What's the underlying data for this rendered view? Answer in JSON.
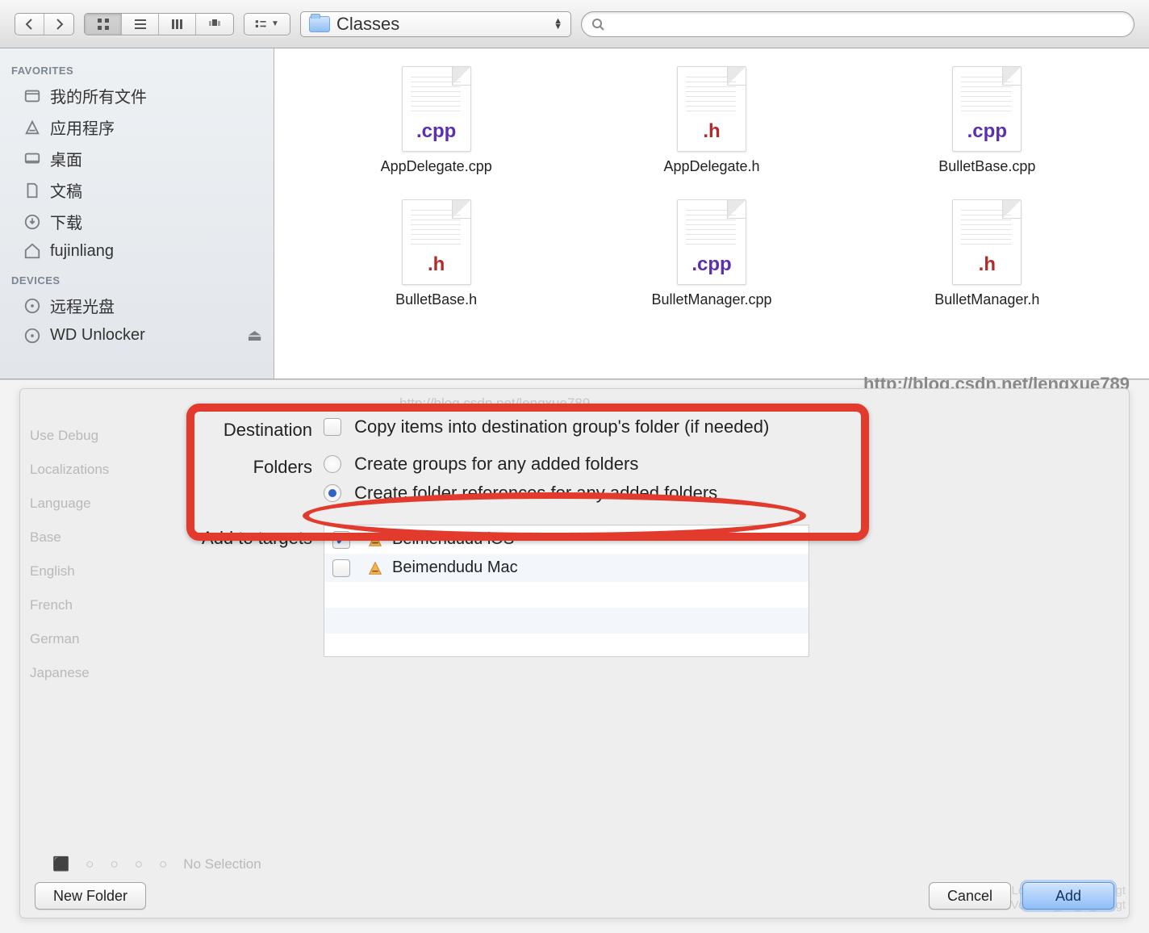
{
  "toolbar": {
    "path_label": "Classes",
    "search_placeholder": ""
  },
  "sidebar": {
    "section_favorites": "FAVORITES",
    "section_devices": "DEVICES",
    "favorites": [
      {
        "label": "我的所有文件",
        "icon": "all-files"
      },
      {
        "label": "应用程序",
        "icon": "apps"
      },
      {
        "label": "桌面",
        "icon": "desktop"
      },
      {
        "label": "文稿",
        "icon": "documents"
      },
      {
        "label": "下载",
        "icon": "downloads"
      },
      {
        "label": "fujinliang",
        "icon": "home"
      }
    ],
    "devices": [
      {
        "label": "远程光盘",
        "icon": "disc",
        "eject": false
      },
      {
        "label": "WD Unlocker",
        "icon": "disc",
        "eject": true
      }
    ]
  },
  "files": [
    {
      "name": "AppDelegate.cpp",
      "ext": ".cpp",
      "cls": "cpp"
    },
    {
      "name": "AppDelegate.h",
      "ext": ".h",
      "cls": "h"
    },
    {
      "name": "BulletBase.cpp",
      "ext": ".cpp",
      "cls": "cpp"
    },
    {
      "name": "BulletBase.h",
      "ext": ".h",
      "cls": "h"
    },
    {
      "name": "BulletManager.cpp",
      "ext": ".cpp",
      "cls": "cpp"
    },
    {
      "name": "BulletManager.h",
      "ext": ".h",
      "cls": "h"
    }
  ],
  "sheet": {
    "watermark_bold": "http://blog.csdn.net/lengxue789",
    "watermark_faint": "http://blog.csdn.net/lengxue789",
    "destination_label": "Destination",
    "copy_items_label": "Copy items into destination group's folder (if needed)",
    "folders_label": "Folders",
    "create_groups_label": "Create groups for any added folders",
    "create_refs_label": "Create folder references for any added folders",
    "targets_label": "Add to targets",
    "targets": [
      {
        "name": "Beimendudu iOS",
        "checked": true
      },
      {
        "name": "Beimendudu Mac",
        "checked": false
      }
    ],
    "new_folder": "New Folder",
    "cancel": "Cancel",
    "add": "Add"
  },
  "ghost": {
    "items": [
      "Use    Debug",
      "Localizations",
      "Language",
      "Base",
      "English",
      "French",
      "German",
      "Japanese"
    ],
    "no_selection": "No Selection",
    "code1": "Locat24_31_A_.inf|gt",
    "code2": "Vocat24_31_A_.inf|gt"
  }
}
